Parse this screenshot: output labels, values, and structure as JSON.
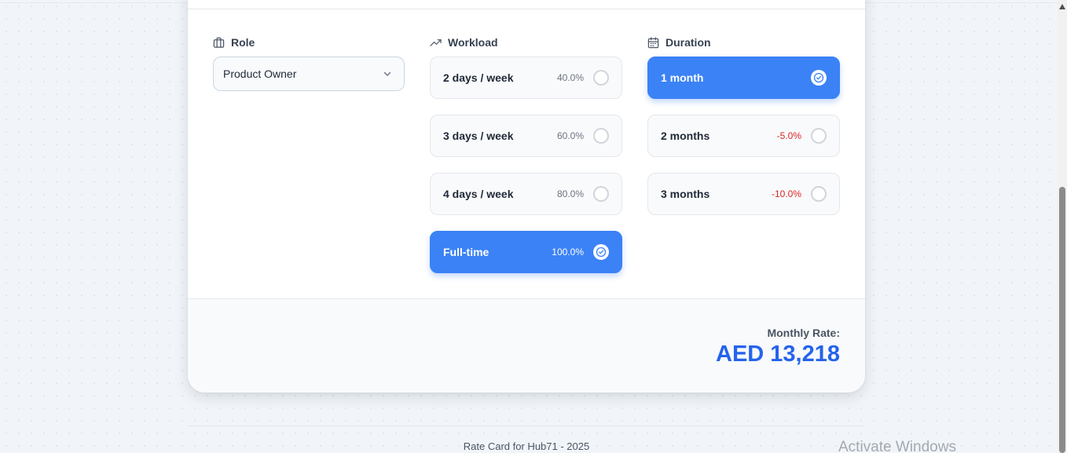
{
  "role": {
    "heading": "Role",
    "icon": "briefcase-icon",
    "selected": "Product Owner"
  },
  "workload": {
    "heading": "Workload",
    "icon": "trending-up-icon",
    "options": [
      {
        "label": "2 days / week",
        "pct": "40.0%",
        "selected": false
      },
      {
        "label": "3 days / week",
        "pct": "60.0%",
        "selected": false
      },
      {
        "label": "4 days / week",
        "pct": "80.0%",
        "selected": false
      },
      {
        "label": "Full-time",
        "pct": "100.0%",
        "selected": true
      }
    ]
  },
  "duration": {
    "heading": "Duration",
    "icon": "calendar-icon",
    "options": [
      {
        "label": "1 month",
        "pct": "",
        "selected": true
      },
      {
        "label": "2 months",
        "pct": "-5.0%",
        "selected": false
      },
      {
        "label": "3 months",
        "pct": "-10.0%",
        "selected": false
      }
    ]
  },
  "rate": {
    "label": "Monthly Rate:",
    "value": "AED 13,218"
  },
  "footer": {
    "text": "Rate Card for Hub71 - 2025"
  },
  "watermark": "Activate Windows",
  "colors": {
    "accent": "#3b82f6",
    "rate": "#2563eb",
    "negative": "#dc2626"
  }
}
